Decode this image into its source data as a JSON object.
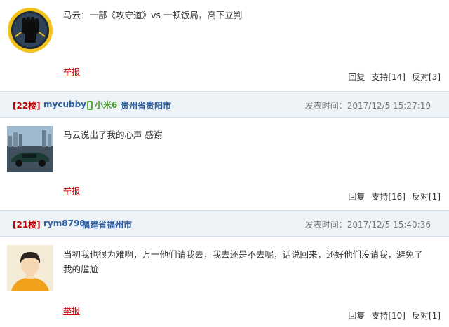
{
  "posts": [
    {
      "content": "马云：一部《攻守道》vs 一顿饭局，高下立判",
      "report": "举报",
      "reply": "回复",
      "support": "支持[14]",
      "oppose": "反对[3]"
    },
    {
      "floor": "[22楼]",
      "user": "mycubby",
      "device": "小米6",
      "location": "贵州省贵阳市",
      "time_label": "发表时间：2017/12/5 15:27:19",
      "content": "马云说出了我的心声 感谢",
      "report": "举报",
      "reply": "回复",
      "support": "支持[16]",
      "oppose": "反对[1]"
    },
    {
      "floor": "[21楼]",
      "user": "rym8790",
      "location": "福建省福州市",
      "time_label": "发表时间：2017/12/5 15:40:36",
      "content": "当初我也很为难啊，万一他们请我去，我去还是不去呢，话说回来，还好他们没请我，避免了我的尴尬",
      "report": "举报",
      "reply": "回复",
      "support": "支持[10]",
      "oppose": "反对[1]"
    }
  ],
  "colors": {
    "floor": "#c40000",
    "username": "#2e5e9e",
    "device": "#4a9a2a",
    "header_bg": "#eef3f8"
  },
  "icons": [
    "fist-logo-avatar",
    "car-photo-avatar",
    "default-user-avatar",
    "phone-icon"
  ]
}
